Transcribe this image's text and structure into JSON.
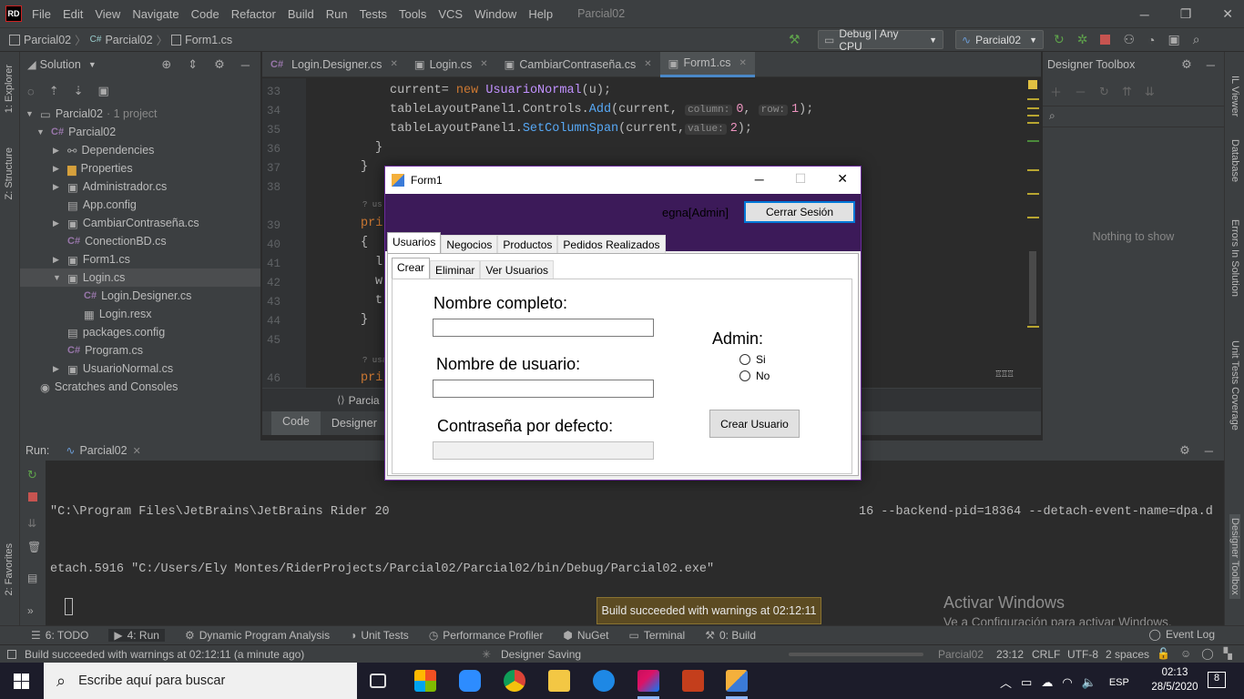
{
  "menubar": {
    "logo": "RD",
    "items": [
      "File",
      "Edit",
      "View",
      "Navigate",
      "Code",
      "Refactor",
      "Build",
      "Run",
      "Tests",
      "Tools",
      "VCS",
      "Window",
      "Help"
    ],
    "project": "Parcial02"
  },
  "navbar": {
    "breadcrumb": [
      "Parcial02",
      "Parcial02",
      "Form1.cs"
    ],
    "config": "Debug | Any CPU",
    "run_config": "Parcial02"
  },
  "left_strip": {
    "explorer": "1: Explorer",
    "structure": "Z: Structure",
    "favorites": "2: Favorites"
  },
  "right_strip": {
    "il_viewer": "IL Viewer",
    "database": "Database",
    "errors": "Errors In Solution",
    "coverage": "Unit Tests Coverage",
    "designer_toolbox": "Designer Toolbox"
  },
  "solution": {
    "title": "Solution",
    "root": "Parcial02",
    "root_meta": "· 1 project",
    "items": [
      {
        "label": "Parcial02",
        "kind": "C#"
      },
      {
        "label": "Dependencies",
        "kind": "dep"
      },
      {
        "label": "Properties",
        "kind": "folder"
      },
      {
        "label": "Administrador.cs",
        "kind": "form"
      },
      {
        "label": "App.config",
        "kind": "config"
      },
      {
        "label": "CambiarContraseña.cs",
        "kind": "form"
      },
      {
        "label": "ConectionBD.cs",
        "kind": "C#"
      },
      {
        "label": "Form1.cs",
        "kind": "form"
      },
      {
        "label": "Login.cs",
        "kind": "form"
      },
      {
        "label": "Login.Designer.cs",
        "kind": "C#"
      },
      {
        "label": "Login.resx",
        "kind": "resx"
      },
      {
        "label": "packages.config",
        "kind": "config"
      },
      {
        "label": "Program.cs",
        "kind": "C#"
      },
      {
        "label": "UsuarioNormal.cs",
        "kind": "form"
      },
      {
        "label": "Scratches and Consoles",
        "kind": "scratch"
      }
    ]
  },
  "editor": {
    "tabs": [
      "Login.Designer.cs",
      "Login.cs",
      "CambiarContraseña.cs",
      "Form1.cs"
    ],
    "active_tab": "Form1.cs",
    "line_numbers": [
      "33",
      "34",
      "35",
      "36",
      "37",
      "38",
      "39",
      "40",
      "41",
      "42",
      "43",
      "44",
      "45",
      "46"
    ],
    "line33": {
      "var": "current",
      "kw": "new",
      "type": "UsuarioNormal",
      "arg": "(u);"
    },
    "line34": {
      "obj": "tableLayoutPanel1.Controls.",
      "method": "Add",
      "arg": "(current,",
      "hint1": "column:",
      "v1": "0",
      "hint2": "row:",
      "v2": "1",
      "end": ");"
    },
    "line35": {
      "obj": "tableLayoutPanel1.",
      "method": "SetColumnSpan",
      "arg": "(current,",
      "hint": "value:",
      "v": "2",
      "end": ");"
    },
    "brace_close": "}",
    "brace_open": "{",
    "pri": "pri",
    "usages": "? us",
    "usages2": "? usa",
    "frag41": "l",
    "frag42": "w",
    "frag43": "t",
    "bottom_crumb": "Parcia",
    "bottom_tabs": [
      "Code",
      "Designer"
    ]
  },
  "toolbox": {
    "title": "Designer Toolbox",
    "empty": "Nothing to show"
  },
  "run": {
    "label": "Run:",
    "tab": "Parcial02",
    "console_line1": "\"C:\\Program Files\\JetBrains\\JetBrains Rider 20",
    "console_line1_tail": "16 --backend-pid=18364 --detach-event-name=dpa.d",
    "console_line2": "etach.5916 \"C:/Users/Ely Montes/RiderProjects/Parcial02/Parcial02/bin/Debug/Parcial02.exe\""
  },
  "form1": {
    "title": "Form1",
    "user": "egna[Admin]",
    "logout_button": "Cerrar Sesión",
    "main_tabs": [
      "Usuarios",
      "Negocios",
      "Productos",
      "Pedidos Realizados"
    ],
    "sub_tabs": [
      "Crear",
      "Eliminar",
      "Ver Usuarios"
    ],
    "full_name_label": "Nombre completo:",
    "username_label": "Nombre de usuario:",
    "password_label": "Contraseña por defecto:",
    "admin_label": "Admin:",
    "radio_yes": "Si",
    "radio_no": "No",
    "create_button": "Crear Usuario"
  },
  "notification": "Build succeeded with warnings at 02:12:11",
  "activate_windows": {
    "title": "Activar Windows",
    "subtitle": "Ve a Configuración para activar Windows."
  },
  "bottom_tools": [
    "6: TODO",
    "4: Run",
    "Dynamic Program Analysis",
    "Unit Tests",
    "Performance Profiler",
    "NuGet",
    "Terminal",
    "0: Build"
  ],
  "event_log": "Event Log",
  "status": {
    "message": "Build succeeded with warnings at 02:12:11 (a minute ago)",
    "designer": "Designer Saving",
    "project": "Parcial02",
    "position": "23:12",
    "line_ending": "CRLF",
    "encoding": "UTF-8",
    "indent": "2 spaces"
  },
  "taskbar": {
    "search_placeholder": "Escribe aquí para buscar",
    "lang": "ESP",
    "time": "02:13",
    "date": "28/5/2020",
    "notifications": "8"
  },
  "colors": {
    "ide_bg": "#2b2b2b",
    "panel_bg": "#3c3f41",
    "form_header": "#3c1a59",
    "accent_blue": "#4a88c7"
  }
}
